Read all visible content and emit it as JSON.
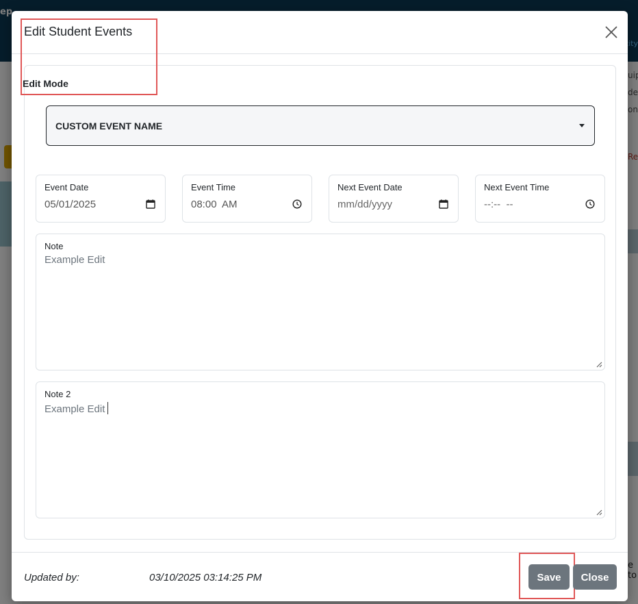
{
  "background": {
    "brand_fragment": "ep",
    "link_fragment": "tity",
    "right_fragments": [
      "uip",
      "de:",
      "ont"
    ],
    "right_red_fragment": "Re",
    "right_footer_fragment": "e to"
  },
  "modal": {
    "title": "Edit Student Events",
    "close_label": "×",
    "card_title": "Edit Mode",
    "event_select": {
      "selected": "CUSTOM EVENT NAME"
    },
    "fields": [
      {
        "label": "Event Date",
        "value": "05/01/2025",
        "icon": "calendar-icon",
        "placeholder": false
      },
      {
        "label": "Event Time",
        "value": "08:00  AM",
        "icon": "clock-icon",
        "placeholder": false
      },
      {
        "label": "Next Event Date",
        "value": "mm/dd/yyyy",
        "icon": "calendar-icon",
        "placeholder": true
      },
      {
        "label": "Next Event Time",
        "value": "--:--  --",
        "icon": "clock-icon",
        "placeholder": true
      }
    ],
    "note": {
      "label": "Note",
      "value": "Example Edit"
    },
    "note2": {
      "label": "Note 2",
      "value": "Example Edit"
    },
    "footer": {
      "updated_label": "Updated by:",
      "updated_value": "03/10/2025 03:14:25 PM",
      "save_label": "Save",
      "close_label": "Close"
    }
  },
  "colors": {
    "highlight": "#e05656",
    "button": "#6c757d",
    "topbar": "#0d3b57"
  }
}
